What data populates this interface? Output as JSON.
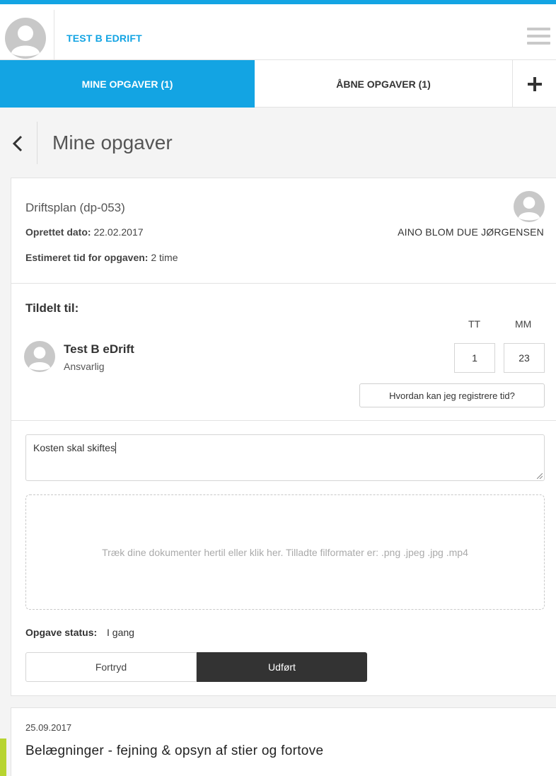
{
  "header": {
    "app_title": "TEST B EDRIFT",
    "avatar_icon": "user-avatar-icon",
    "menu_icon": "hamburger-menu-icon",
    "accent_color": "#13a4e3"
  },
  "tabs": {
    "my_tasks": "MINE OPGAVER (1)",
    "open_tasks": "ÅBNE OPGAVER (1)",
    "add_icon": "plus-icon"
  },
  "page": {
    "back_icon": "chevron-left-icon",
    "title": "Mine opgaver"
  },
  "task": {
    "plan_title": "Driftsplan (dp-053)",
    "created_label": "Oprettet dato:",
    "created_value": "22.02.2017",
    "estimate_label": "Estimeret tid for opgaven:",
    "estimate_value": "2 time",
    "creator_name": "AINO BLOM DUE JØRGENSEN",
    "assigned_heading": "Tildelt til:",
    "hours_label": "TT",
    "minutes_label": "MM",
    "assignee_name": "Test B eDrift",
    "assignee_role": "Ansvarlig",
    "hours_value": "1",
    "minutes_value": "23",
    "help_button": "Hvordan kan jeg registrere tid?",
    "note_text": "Kosten skal skiftes",
    "dropzone_text": "Træk dine dokumenter hertil eller klik her. Tilladte filformater er:  .png .jpeg .jpg .mp4",
    "status_label": "Opgave status:",
    "status_value": "I gang",
    "cancel_button": "Fortryd",
    "done_button": "Udført"
  },
  "next_task": {
    "date": "25.09.2017",
    "title": "Belægninger - fejning & opsyn af stier og fortove",
    "accent_color": "#b7d430"
  }
}
